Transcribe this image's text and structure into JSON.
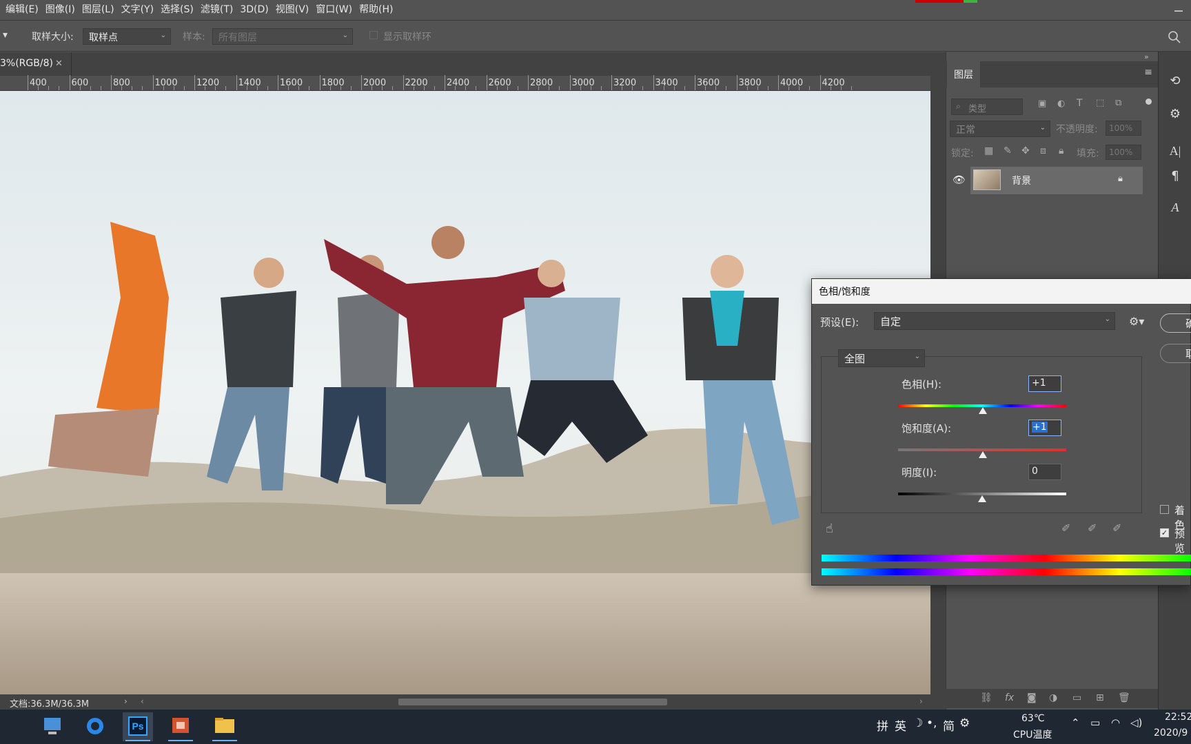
{
  "menubar": {
    "items": [
      "编辑(E)",
      "图像(I)",
      "图层(L)",
      "文字(Y)",
      "选择(S)",
      "滤镜(T)",
      "3D(D)",
      "视图(V)",
      "窗口(W)",
      "帮助(H)"
    ]
  },
  "options_bar": {
    "sample_size_label": "取样大小:",
    "sample_size_value": "取样点",
    "sample_label": "样本:",
    "sample_value": "所有图层",
    "show_ring_label": "显示取样环"
  },
  "document": {
    "tab_label": "3%(RGB/8)",
    "status": "文档:36.3M/36.3M"
  },
  "ruler": {
    "labels": [
      "400",
      "600",
      "800",
      "1000",
      "1200",
      "1400",
      "1600",
      "1800",
      "2000",
      "2200",
      "2400",
      "2600",
      "2800",
      "3000",
      "3200",
      "3400",
      "3600",
      "3800",
      "4000",
      "4200"
    ]
  },
  "layers_panel": {
    "tab_label": "图层",
    "filter_placeholder": "类型",
    "blend_mode": "正常",
    "opacity_label": "不透明度:",
    "opacity_value": "100%",
    "lock_label": "锁定:",
    "fill_label": "填充:",
    "fill_value": "100%",
    "layer_name": "背景"
  },
  "dialog": {
    "title": "色相/饱和度",
    "preset_label": "预设(E):",
    "preset_value": "自定",
    "ok_label": "确",
    "cancel_label": "取",
    "range_value": "全图",
    "hue_label": "色相(H):",
    "hue_value": "+1",
    "saturation_label": "饱和度(A):",
    "saturation_value": "+1",
    "lightness_label": "明度(I):",
    "lightness_value": "0",
    "colorize_label": "着色",
    "preview_label": "预览",
    "preview_checked": true,
    "hue_level": 1,
    "saturation_level": 1,
    "lightness_level": 0
  },
  "taskbar": {
    "ime_items": [
      "拼",
      "英",
      "简"
    ],
    "cpu_temp": "63℃",
    "cpu_label": "CPU温度",
    "clock_time": "22:52",
    "clock_date": "2020/9"
  },
  "colors": {
    "ui_bg": "#535353",
    "panel_dark": "#424242",
    "accent_blue": "#31a8ff",
    "taskbar": "#1f2733"
  }
}
